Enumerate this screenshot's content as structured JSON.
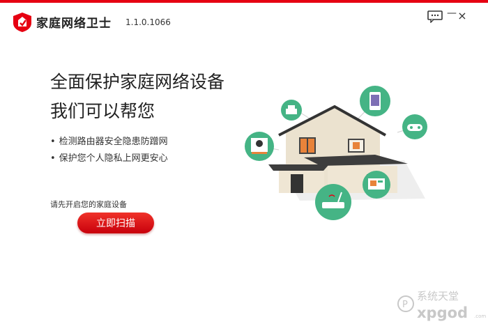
{
  "header": {
    "app_title": "家庭网络卫士",
    "version": "1.1.0.1066",
    "accent_color": "#e60012",
    "icons": {
      "logo": "shield-logo-icon",
      "feedback": "feedback-icon",
      "minimize": "minimize-icon",
      "close": "close-icon"
    },
    "minimize_glyph": "—",
    "close_glyph": "×"
  },
  "main": {
    "headline_line1": "全面保护家庭网络设备",
    "headline_line2": "我们可以帮您",
    "bullets": [
      "检测路由器安全隐患防蹭网",
      "保护您个人隐私上网更安心"
    ],
    "hint": "请先开启您的家庭设备",
    "scan_button_label": "立即扫描"
  },
  "illustration": {
    "device_icons": [
      "printer-icon",
      "phone-icon",
      "gamepad-icon",
      "set-top-box-icon",
      "router-icon",
      "tv-icon"
    ]
  },
  "watermark": {
    "text": "系统天堂",
    "domain": "xpgod.com"
  }
}
